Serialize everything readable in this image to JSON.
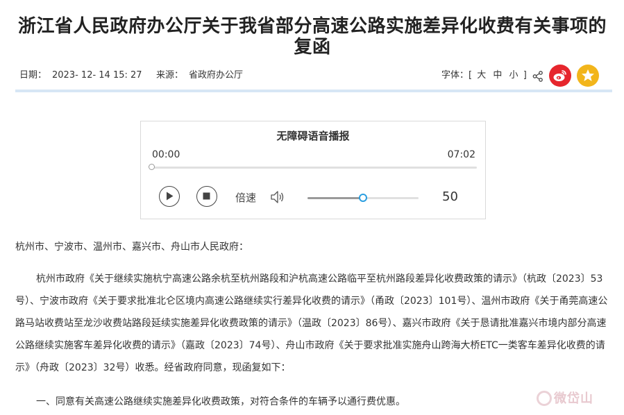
{
  "article": {
    "title": "浙江省人民政府办公厅关于我省部分高速公路实施差异化收费有关事项的复函",
    "date_label": "日期：",
    "date_value": "2023- 12- 14 15: 27",
    "source_label": "来源：",
    "source_value": "省政府办公厅",
    "font_size_label": "字体：[",
    "font_size_options": [
      "大",
      "中",
      "小"
    ],
    "font_size_close": "]"
  },
  "player": {
    "title": "无障碍语音播报",
    "current_time": "00:00",
    "total_time": "07:02",
    "progress": 0,
    "speed_label": "倍速",
    "volume": 50,
    "volume_display": "50"
  },
  "content": {
    "greeting": "杭州市、宁波市、温州市、嘉兴市、舟山市人民政府：",
    "main_paragraph": "杭州市政府《关于继续实施杭宁高速公路余杭至杭州路段和沪杭高速公路临平至杭州路段差异化收费政策的请示》（杭政〔2023〕53号）、宁波市政府《关于要求批准北仑区境内高速公路继续实行差异化收费的请示》（甬政〔2023〕101号）、温州市政府《关于甬莞高速公路马站收费站至龙沙收费站路段延续实施差异化收费政策的请示》（温政〔2023〕86号）、嘉兴市政府《关于恳请批准嘉兴市境内部分高速公路继续实施客车差异化收费的请示》（嘉政〔2023〕74号）、舟山市政府《关于要求批准实施舟山跨海大桥ETC一类客车差异化收费的请示》（舟政〔2023〕32号）收悉。经省政府同意，现函复如下：",
    "item_1": "一、同意有关高速公路继续实施差异化收费政策，对符合条件的车辆予以通行费优惠。"
  },
  "watermark": {
    "text": "微岱山"
  },
  "colors": {
    "divider": "#d7e6f5",
    "weibo": "#e6262d",
    "favorite": "#f2b51b",
    "volume_knob": "#2a9ee0"
  },
  "icons": {
    "share": "share-icon",
    "weibo": "weibo-icon",
    "favorite": "star-icon",
    "play": "play-icon",
    "stop": "stop-icon",
    "volume": "volume-icon"
  }
}
